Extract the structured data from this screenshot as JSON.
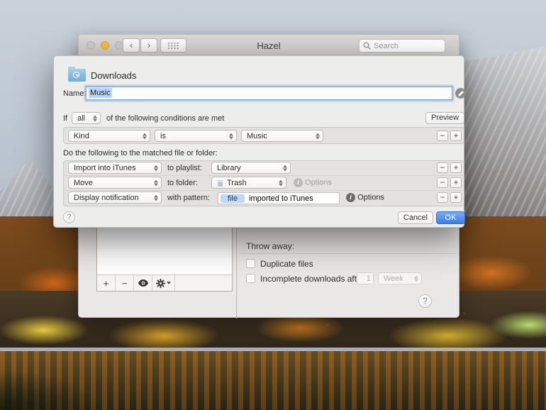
{
  "colors": {
    "accent_blue": "#3a7de7",
    "selection_highlight": "#b5d7fb",
    "token_blue": "#bcd8f5",
    "traffic_minimize_yellow": "#f6be40",
    "traffic_inactive_gray": "#cecccb"
  },
  "window": {
    "title": "Hazel",
    "nav": {
      "back_glyph": "‹",
      "forward_glyph": "›"
    },
    "search": {
      "placeholder": "Search"
    },
    "list_toolbar": {
      "add_glyph": "+",
      "remove_glyph": "−"
    },
    "right_panel": {
      "throw_away_label": "Throw away:",
      "duplicate_label": "Duplicate files",
      "incomplete_label": "Incomplete downloads after",
      "incomplete_value": "1",
      "incomplete_unit": "Week"
    },
    "help_glyph": "?"
  },
  "dialog": {
    "title": "Downloads",
    "name_label": "Name:",
    "name_value": "Music",
    "if_label": "If",
    "match_mode": "all",
    "conditions_suffix": "of the following conditions are met",
    "preview_label": "Preview",
    "condition": {
      "attribute": "Kind",
      "operator": "is",
      "value": "Music"
    },
    "do_label": "Do the following to the matched file or folder:",
    "actions": [
      {
        "action": "Import into iTunes",
        "param_label": "to playlist:",
        "value": "Library"
      },
      {
        "action": "Move",
        "param_label": "to folder:",
        "value": "Trash",
        "options_label": "Options"
      },
      {
        "action": "Display notification",
        "param_label": "with pattern:",
        "token": "file",
        "pattern": "imported to iTunes",
        "options_label": "Options"
      }
    ],
    "row_buttons": {
      "remove_glyph": "−",
      "add_glyph": "+"
    },
    "info_glyph": "i",
    "help_glyph": "?",
    "cancel_label": "Cancel",
    "ok_label": "OK"
  }
}
